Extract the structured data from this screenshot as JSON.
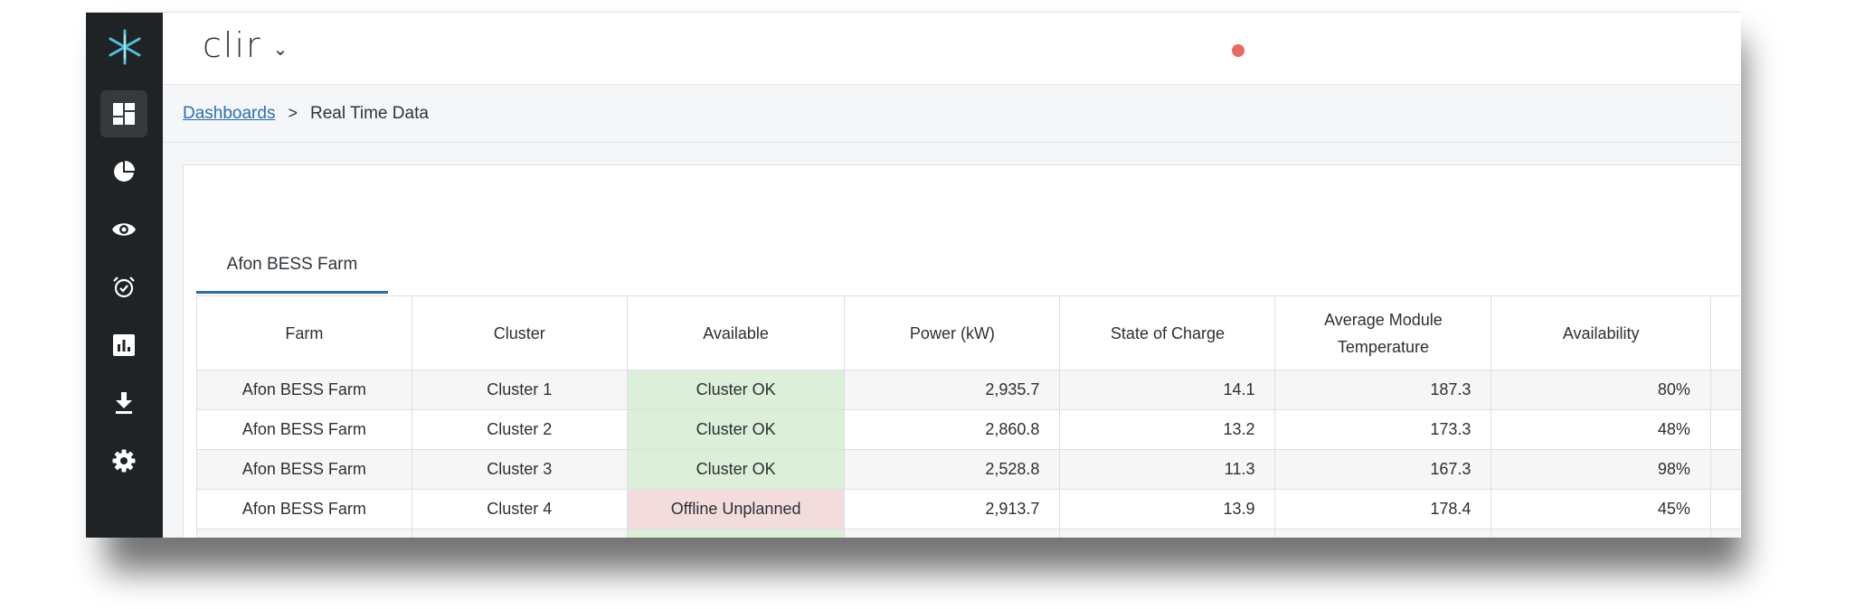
{
  "app": {
    "brand": "clir",
    "brand_chevron": "⌄",
    "status_dot_color": "#ea6a5e"
  },
  "sidebar": {
    "logo": "clir-star-logo",
    "items": [
      {
        "name": "dashboard-icon",
        "active": true
      },
      {
        "name": "pie-chart-icon",
        "active": false
      },
      {
        "name": "eye-icon",
        "active": false
      },
      {
        "name": "alarm-clock-icon",
        "active": false
      },
      {
        "name": "bar-report-icon",
        "active": false
      },
      {
        "name": "download-icon",
        "active": false
      },
      {
        "name": "gear-icon",
        "active": false
      }
    ]
  },
  "breadcrumb": {
    "parent": "Dashboards",
    "separator": ">",
    "current": "Real Time Data"
  },
  "tabs": [
    {
      "label": "Afon BESS Farm",
      "active": true
    }
  ],
  "table": {
    "headers": {
      "farm": "Farm",
      "cluster": "Cluster",
      "available": "Available",
      "power": "Power (kW)",
      "soc": "State of Charge",
      "temp_line1": "Average Module",
      "temp_line2": "Temperature",
      "availability": "Availability"
    },
    "rows": [
      {
        "farm": "Afon BESS Farm",
        "cluster": "Cluster 1",
        "available": "Cluster OK",
        "status": "ok",
        "power": "2,935.7",
        "soc": "14.1",
        "temp": "187.3",
        "availability": "80%"
      },
      {
        "farm": "Afon BESS Farm",
        "cluster": "Cluster 2",
        "available": "Cluster OK",
        "status": "ok",
        "power": "2,860.8",
        "soc": "13.2",
        "temp": "173.3",
        "availability": "48%"
      },
      {
        "farm": "Afon BESS Farm",
        "cluster": "Cluster 3",
        "available": "Cluster OK",
        "status": "ok",
        "power": "2,528.8",
        "soc": "11.3",
        "temp": "167.3",
        "availability": "98%"
      },
      {
        "farm": "Afon BESS Farm",
        "cluster": "Cluster 4",
        "available": "Offline Unplanned",
        "status": "bad",
        "power": "2,913.7",
        "soc": "13.9",
        "temp": "178.4",
        "availability": "45%"
      }
    ],
    "status_colors": {
      "ok": "#dcefd8",
      "bad": "#f3dcdc"
    }
  }
}
